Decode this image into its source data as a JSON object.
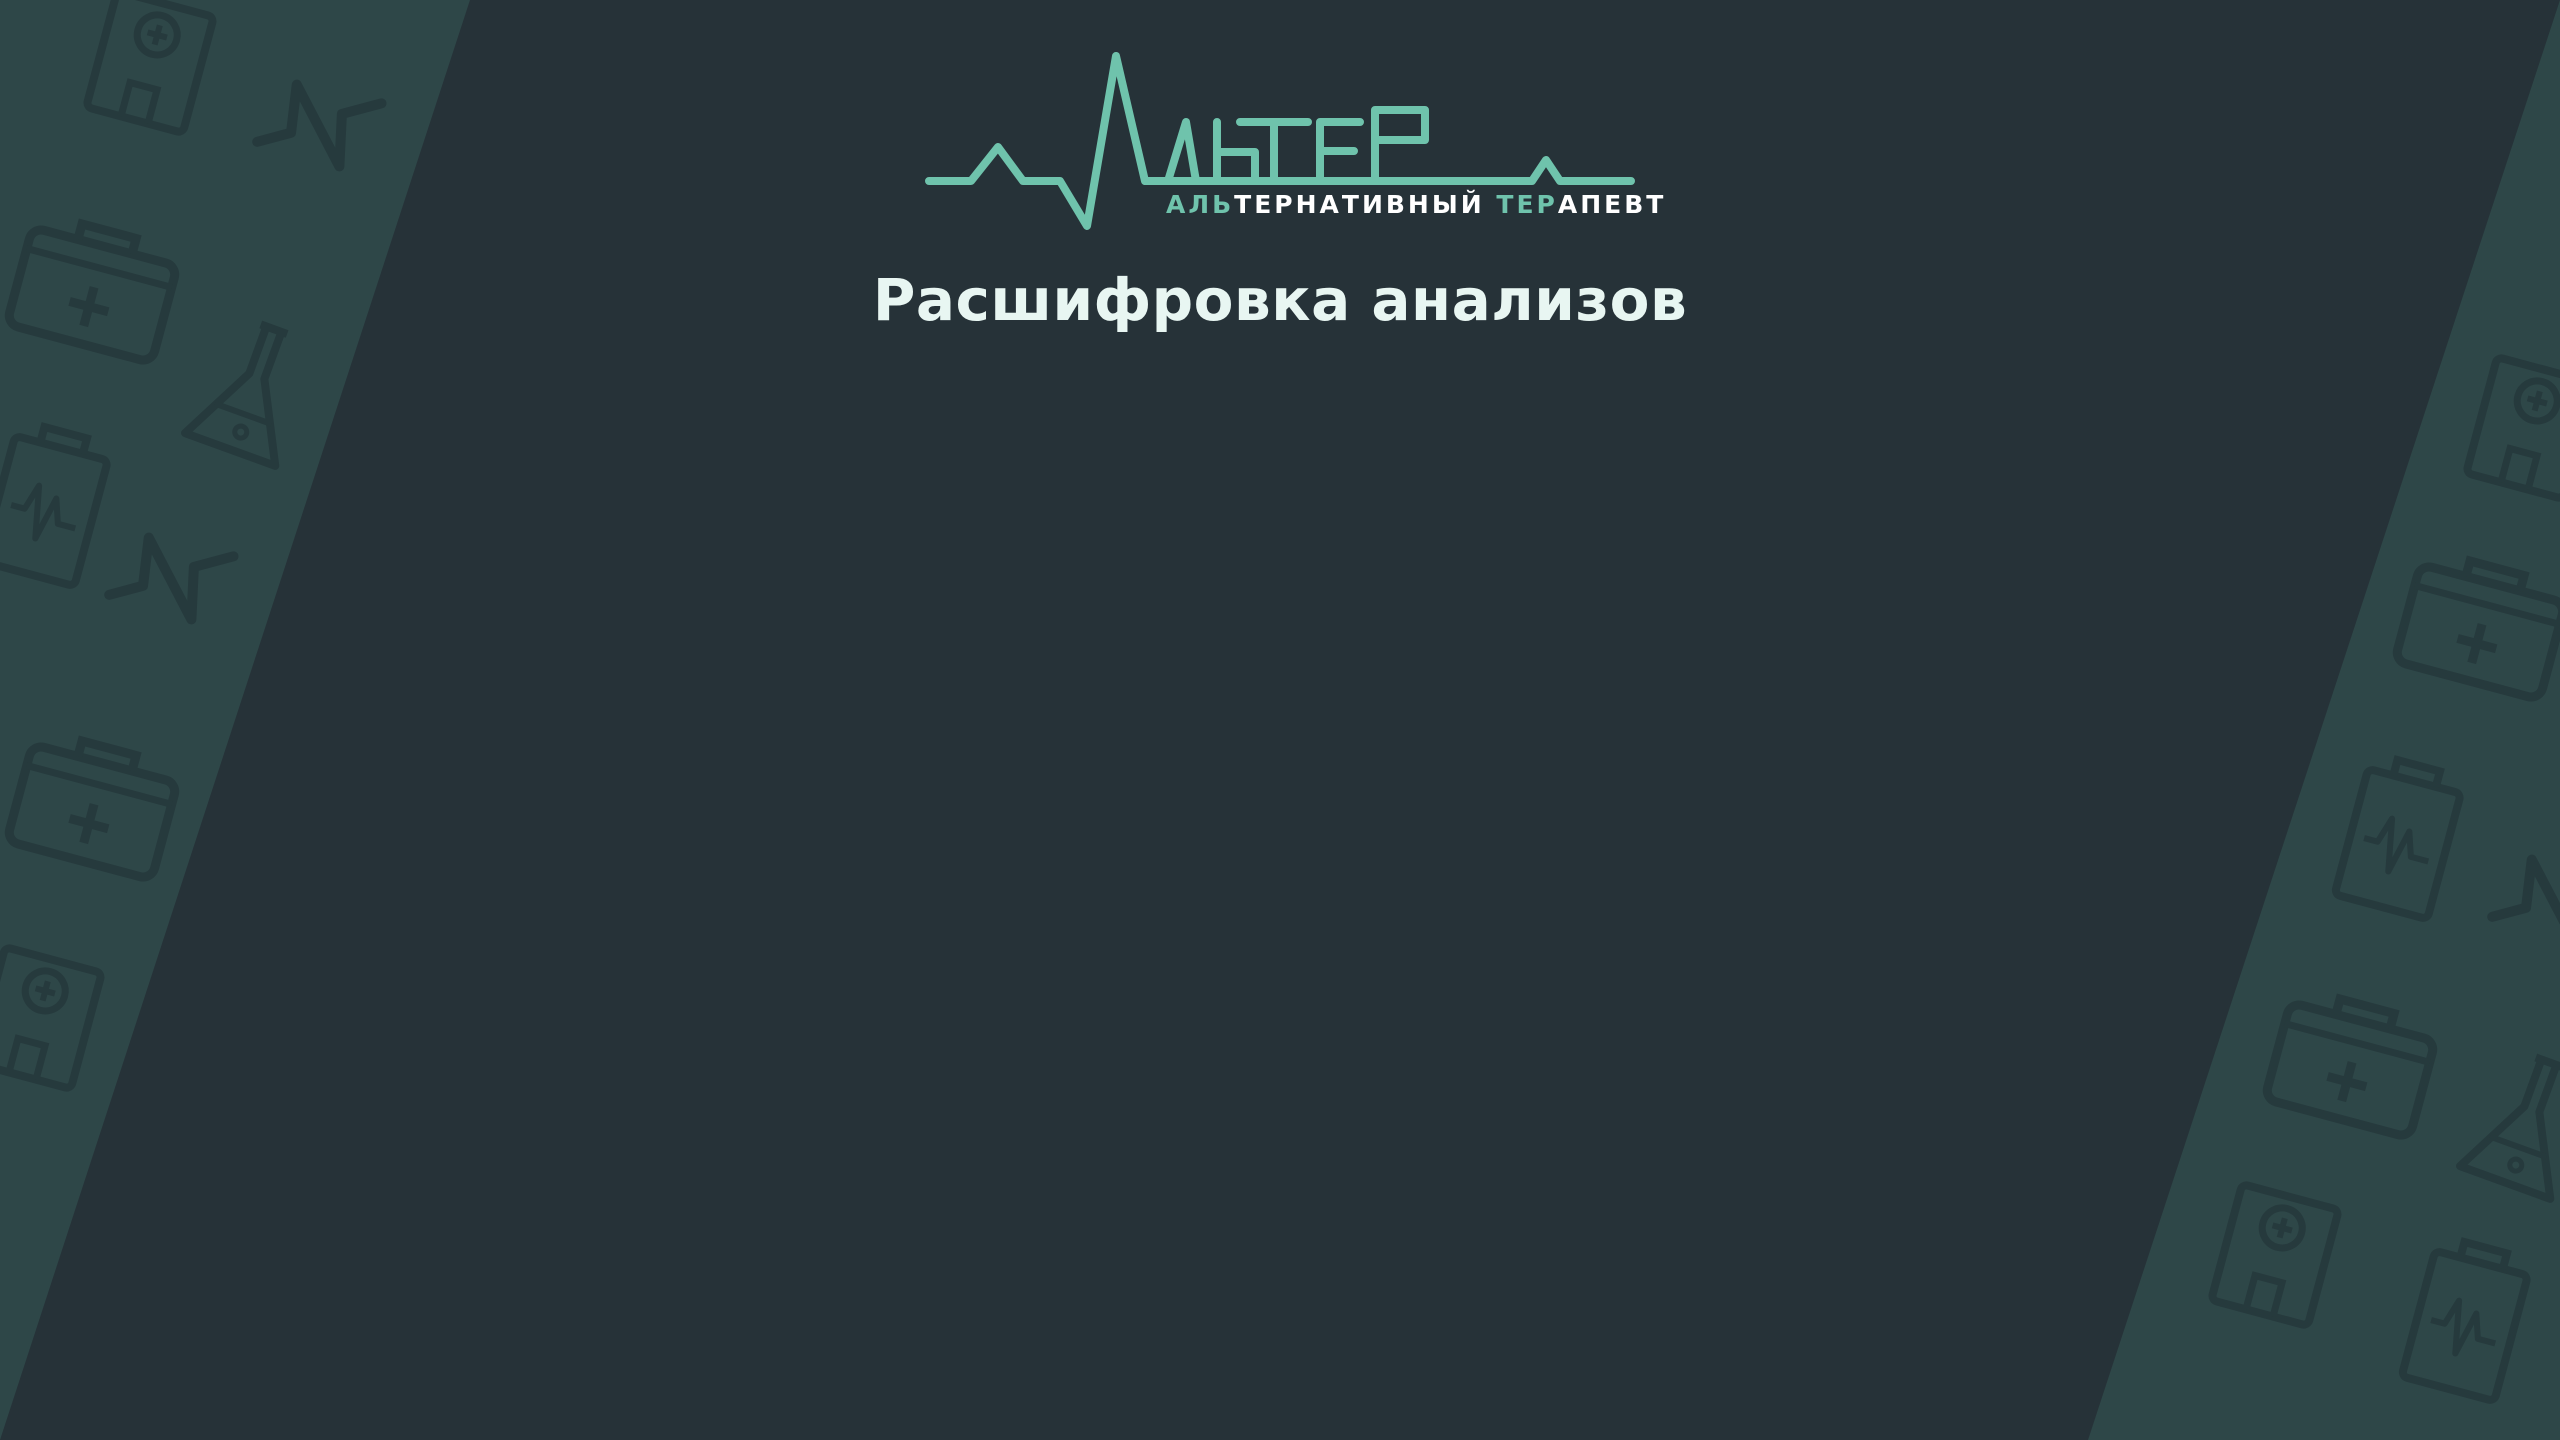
{
  "logo": {
    "wordmark": "АЛЬТЕР",
    "subtitle_parts": [
      {
        "text": "АЛЬ",
        "accent": true
      },
      {
        "text": "ТЕРНАТИВНЫЙ ",
        "accent": false
      },
      {
        "text": "ТЕР",
        "accent": true
      },
      {
        "text": "АПЕВТ",
        "accent": false
      }
    ]
  },
  "page": {
    "title": "Расшифровка анализов"
  },
  "colors": {
    "side_background": "#2e4748",
    "center_background": "#263238",
    "accent": "#6fc3ac",
    "pattern_icon": "#263a3d",
    "title_text": "#e8f6f2"
  },
  "decor_icons": [
    "medical-case-icon",
    "hospital-icon",
    "heartbeat-icon",
    "flask-icon",
    "clipboard-icon"
  ]
}
